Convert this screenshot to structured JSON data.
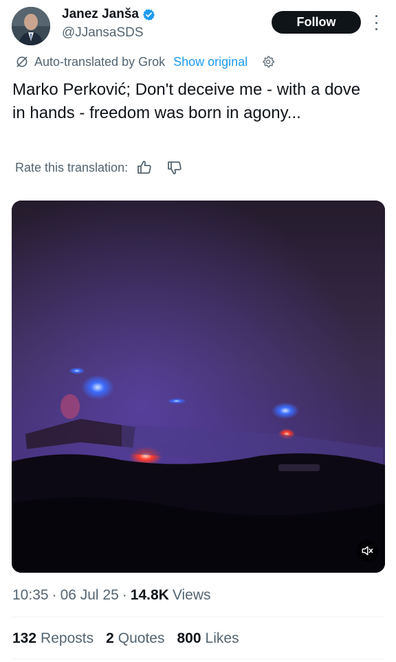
{
  "author": {
    "name": "Janez Janša",
    "handle": "@JJansaSDS",
    "verified": true
  },
  "follow_label": "Follow",
  "translation": {
    "auto_text": "Auto-translated by Grok",
    "show_original": "Show original"
  },
  "tweet_text": "Marko Perković; Don't deceive me - with a dove in hands - freedom was born in agony...",
  "rate": {
    "label": "Rate this translation:"
  },
  "media": {
    "type": "video",
    "muted": true
  },
  "meta": {
    "time": "10:35",
    "date": "06 Jul 25",
    "views_count": "14.8K",
    "views_label": "Views"
  },
  "stats": {
    "reposts_count": "132",
    "reposts_label": "Reposts",
    "quotes_count": "2",
    "quotes_label": "Quotes",
    "likes_count": "800",
    "likes_label": "Likes"
  },
  "colors": {
    "accent": "#1d9bf0",
    "text_primary": "#0f1419",
    "text_secondary": "#536471",
    "follow_bg": "#0f1419"
  },
  "icons": [
    "verified-badge-icon",
    "more-icon",
    "grok-icon",
    "gear-icon",
    "thumbs-up-icon",
    "thumbs-down-icon",
    "mute-icon"
  ]
}
